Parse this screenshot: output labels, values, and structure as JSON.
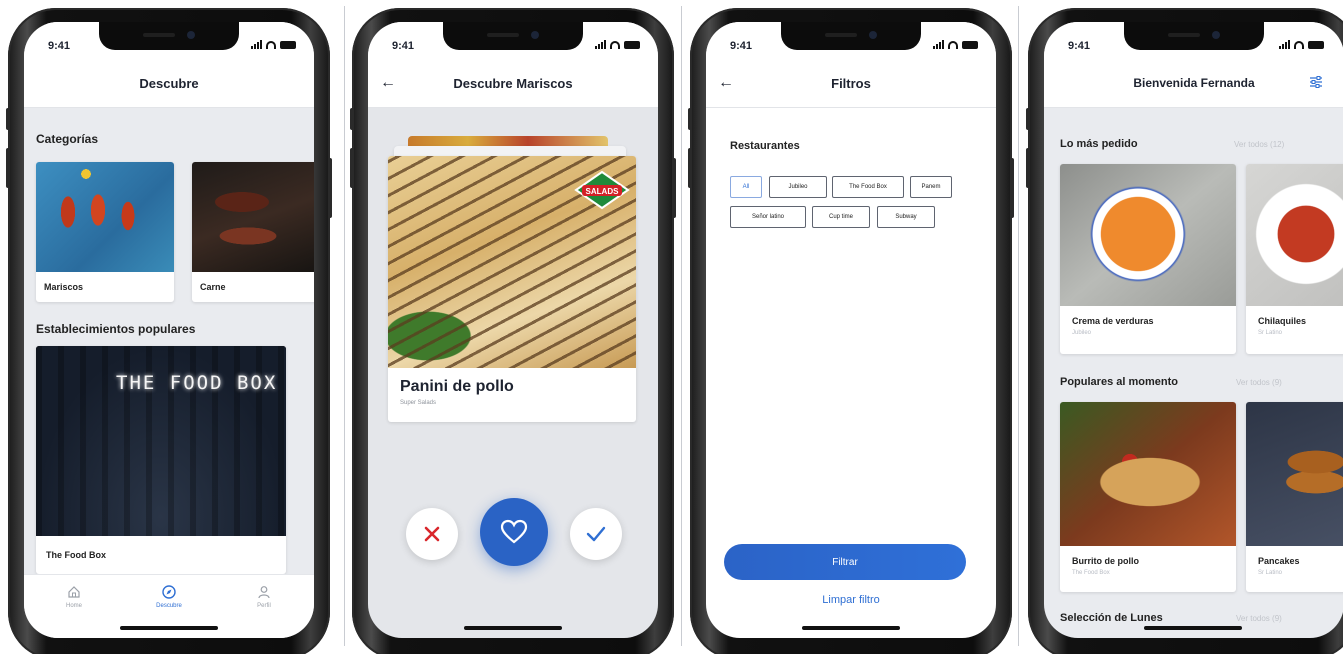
{
  "status": {
    "time": "9:41"
  },
  "colors": {
    "accent": "#2f6fd3",
    "reject": "#d9262b",
    "background": "#e9ebef"
  },
  "screen1": {
    "title": "Descubre",
    "categories_title": "Categorías",
    "categories": [
      {
        "label": "Mariscos",
        "icon": "lobster-image"
      },
      {
        "label": "Carne",
        "icon": "meat-image"
      }
    ],
    "popular_title": "Establecimientos populares",
    "popular": [
      {
        "name": "The Food Box",
        "sign": "THE FOOD BOX"
      }
    ],
    "tabs": [
      {
        "label": "Home",
        "icon": "home-icon"
      },
      {
        "label": "Descubre",
        "icon": "compass-icon",
        "active": true
      },
      {
        "label": "Perfil",
        "icon": "user-icon"
      }
    ]
  },
  "screen2": {
    "title": "Descubre Mariscos",
    "card": {
      "name": "Panini de pollo",
      "restaurant": "Super Salads",
      "logo_text": "SALADS"
    }
  },
  "screen3": {
    "title": "Filtros",
    "section": "Restaurantes",
    "chips": [
      "All",
      "Jubileo",
      "The Food Box",
      "Panem",
      "Señor latino",
      "Cup time",
      "Subway"
    ],
    "selected_chip": "All",
    "apply": "Filtrar",
    "clear": "Limpar filtro"
  },
  "screen4": {
    "title": "Bienvenida Fernanda",
    "sections": [
      {
        "title": "Lo más pedido",
        "see_all": "Ver todos (12)",
        "items": [
          {
            "name": "Crema de verduras",
            "place": "Jubileo"
          },
          {
            "name": "Chilaquiles",
            "place": "Sr Latino"
          }
        ]
      },
      {
        "title": "Populares al momento",
        "see_all": "Ver todos (9)",
        "items": [
          {
            "name": "Burrito de pollo",
            "place": "The Food Box"
          },
          {
            "name": "Pancakes",
            "place": "Sr Latino"
          }
        ]
      },
      {
        "title": "Selección de Lunes",
        "see_all": "Ver todos (9)"
      }
    ]
  }
}
